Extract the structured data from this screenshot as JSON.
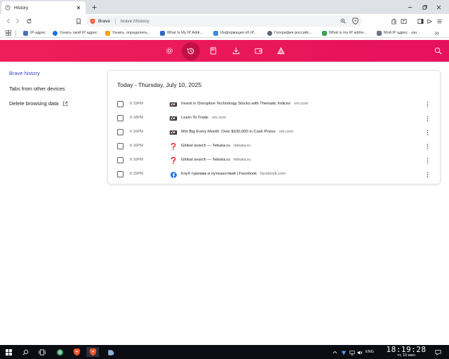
{
  "tab": {
    "title": "History"
  },
  "omnibox": {
    "site_name": "Brave",
    "url": "brave://history"
  },
  "bookmarks": [
    {
      "label": "IP-адрес",
      "color": "#4a6fbf"
    },
    {
      "label": "Узнать свой IP адрес",
      "color": "#1a73e8"
    },
    {
      "label": "Узнать, определить...",
      "color": "#f4a41a"
    },
    {
      "label": "What Is My IP Addr...",
      "color": "#2d6cc0"
    },
    {
      "label": "Информация об IP...",
      "color": "#3b8fd6"
    },
    {
      "label": "География российс...",
      "color": "#5a6470"
    },
    {
      "label": "What is my IP addre...",
      "color": "#34a853"
    },
    {
      "label": "Мой IP адрес - узн...",
      "color": "#6b7480"
    }
  ],
  "header_icons": [
    "gear-icon",
    "history-icon",
    "bookmarks-icon",
    "downloads-icon",
    "wallet-icon",
    "rewards-icon",
    "search-icon"
  ],
  "sidebar": {
    "items": [
      {
        "label": "Brave history"
      },
      {
        "label": "Tabs from other devices"
      },
      {
        "label": "Delete browsing data"
      }
    ]
  },
  "history": {
    "day_title": "Today - Thursday, July 10, 2025",
    "entries": [
      {
        "time": "6:19PM",
        "title": "Invest in Disruptive Technology Stocks with Thematic Indices",
        "domain": "xm.com",
        "icon": "xm"
      },
      {
        "time": "6:18PM",
        "title": "Learn To Trade",
        "domain": "xm.com",
        "icon": "xm"
      },
      {
        "time": "6:16PM",
        "title": "Win Big Every Month: Over $100,000 in Cash Prizes",
        "domain": "xm.com",
        "icon": "xm"
      },
      {
        "time": "6:16PM",
        "title": "Global search — Tebuka.ru",
        "domain": "tebuka.ru",
        "icon": "question"
      },
      {
        "time": "6:16PM",
        "title": "Global search — Tebuka.ru",
        "domain": "tebuka.ru",
        "icon": "question"
      },
      {
        "time": "6:15PM",
        "title": "Клуб туризма и путешествий | Facebook",
        "domain": "facebook.com",
        "icon": "facebook"
      }
    ]
  },
  "taskbar": {
    "lang": "ENG",
    "time": "18:19:28",
    "date": "чт, 10 июл"
  },
  "colors": {
    "accent": "#ee1f5a",
    "link": "#3d45c8"
  }
}
